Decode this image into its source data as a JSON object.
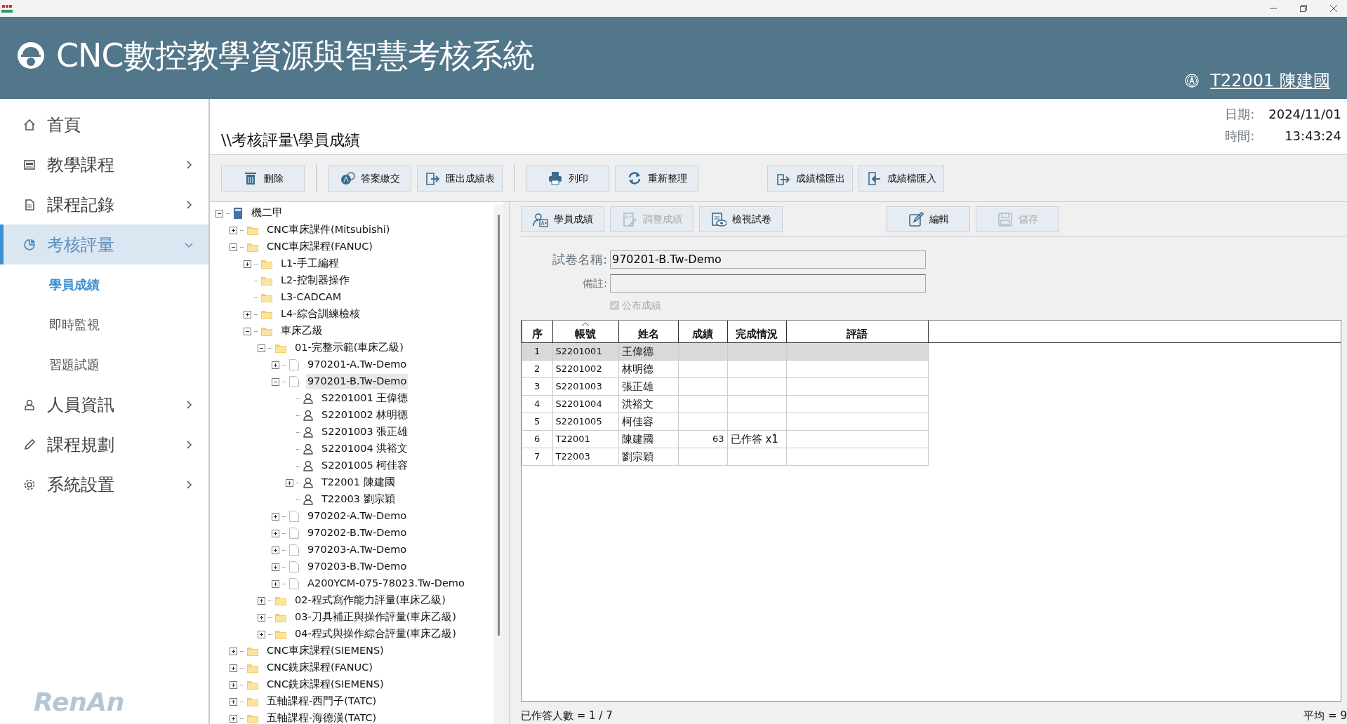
{
  "app": {
    "title": "CNC數控教學資源與智慧考核系統",
    "user": "T22001 陳建國"
  },
  "sidebar": {
    "items": [
      {
        "label": "首頁",
        "selected": false
      },
      {
        "label": "教學課程",
        "selected": false,
        "expanded": false
      },
      {
        "label": "課程記錄",
        "selected": false,
        "expanded": false
      },
      {
        "label": "考核評量",
        "selected": true,
        "expanded": true,
        "children": [
          {
            "label": "學員成績",
            "selected": true
          },
          {
            "label": "即時監視",
            "selected": false
          },
          {
            "label": "習題試題",
            "selected": false
          }
        ]
      },
      {
        "label": "人員資訊",
        "selected": false,
        "expanded": false
      },
      {
        "label": "課程規劃",
        "selected": false,
        "expanded": false
      },
      {
        "label": "系統設置",
        "selected": false,
        "expanded": false
      }
    ],
    "brand": "RenAn"
  },
  "breadcrumb": "\\\\考核評量\\學員成績",
  "date": {
    "label": "日期:",
    "value": "2024/11/01"
  },
  "time": {
    "label": "時間:",
    "value": "13:43:24"
  },
  "toolbar": [
    {
      "label": "刪除",
      "disabled": false,
      "separator_after": true
    },
    {
      "label": "答案繳交",
      "disabled": false,
      "separator_after": false
    },
    {
      "label": "匯出成績表",
      "disabled": false,
      "separator_after": true
    },
    {
      "label": "列印",
      "disabled": false,
      "separator_after": false
    },
    {
      "label": "重新整理",
      "disabled": false,
      "separator_after": false
    },
    {
      "label": "成績檔匯出",
      "disabled": false,
      "separator_after": false
    },
    {
      "label": "成績檔匯入",
      "disabled": false,
      "separator_after": false
    }
  ],
  "tree": [
    {
      "label": "機二甲",
      "kind": "group",
      "expanded": true,
      "selected": false,
      "children": [
        {
          "label": "CNC車床課件(Mitsubishi)",
          "kind": "folder",
          "expanded": false,
          "selected": false
        },
        {
          "label": "CNC車床課程(FANUC)",
          "kind": "folder",
          "expanded": true,
          "selected": false,
          "children": [
            {
              "label": "L1-手工編程",
              "kind": "folder",
              "expanded": false,
              "selected": false
            },
            {
              "label": "L2-控制器操作",
              "kind": "folder",
              "selected": false
            },
            {
              "label": "L3-CADCAM",
              "kind": "folder",
              "selected": false
            },
            {
              "label": "L4-綜合訓練檢核",
              "kind": "folder",
              "expanded": false,
              "selected": false
            },
            {
              "label": "車床乙級",
              "kind": "folder",
              "expanded": true,
              "selected": false,
              "children": [
                {
                  "label": "01-完整示範(車床乙級)",
                  "kind": "folder",
                  "expanded": true,
                  "selected": false,
                  "children": [
                    {
                      "label": "970201-A.Tw-Demo",
                      "kind": "paper",
                      "expanded": false,
                      "selected": false
                    },
                    {
                      "label": "970201-B.Tw-Demo",
                      "kind": "paper",
                      "expanded": true,
                      "selected": true,
                      "children": [
                        {
                          "label": "S2201001 王偉德",
                          "kind": "person",
                          "selected": false
                        },
                        {
                          "label": "S2201002 林明德",
                          "kind": "person",
                          "selected": false
                        },
                        {
                          "label": "S2201003 張正雄",
                          "kind": "person",
                          "selected": false
                        },
                        {
                          "label": "S2201004 洪裕文",
                          "kind": "person",
                          "selected": false
                        },
                        {
                          "label": "S2201005 柯佳容",
                          "kind": "person",
                          "selected": false
                        },
                        {
                          "label": "T22001 陳建國",
                          "kind": "person",
                          "expanded": false,
                          "selected": false
                        },
                        {
                          "label": "T22003 劉宗穎",
                          "kind": "person",
                          "selected": false
                        }
                      ]
                    },
                    {
                      "label": "970202-A.Tw-Demo",
                      "kind": "paper",
                      "expanded": false,
                      "selected": false
                    },
                    {
                      "label": "970202-B.Tw-Demo",
                      "kind": "paper",
                      "expanded": false,
                      "selected": false
                    },
                    {
                      "label": "970203-A.Tw-Demo",
                      "kind": "paper",
                      "expanded": false,
                      "selected": false
                    },
                    {
                      "label": "970203-B.Tw-Demo",
                      "kind": "paper",
                      "expanded": false,
                      "selected": false
                    },
                    {
                      "label": "A200YCM-075-78023.Tw-Demo",
                      "kind": "paper",
                      "expanded": false,
                      "selected": false
                    }
                  ]
                },
                {
                  "label": "02-程式寫作能力評量(車床乙級)",
                  "kind": "folder",
                  "expanded": false,
                  "selected": false
                },
                {
                  "label": "03-刀具補正與操作評量(車床乙級)",
                  "kind": "folder",
                  "expanded": false,
                  "selected": false
                },
                {
                  "label": "04-程式與操作綜合評量(車床乙級)",
                  "kind": "folder",
                  "expanded": false,
                  "selected": false
                }
              ]
            }
          ]
        },
        {
          "label": "CNC車床課程(SIEMENS)",
          "kind": "folder",
          "expanded": false,
          "selected": false
        },
        {
          "label": "CNC銑床課程(FANUC)",
          "kind": "folder",
          "expanded": false,
          "selected": false
        },
        {
          "label": "CNC銑床課程(SIEMENS)",
          "kind": "folder",
          "expanded": false,
          "selected": false
        },
        {
          "label": "五軸課程-西門子(TATC)",
          "kind": "folder",
          "expanded": false,
          "selected": false
        },
        {
          "label": "五軸課程-海德漢(TATC)",
          "kind": "folder",
          "expanded": false,
          "selected": false
        }
      ]
    }
  ],
  "tabs": [
    {
      "label": "學員成績",
      "disabled": false
    },
    {
      "label": "調整成績",
      "disabled": true
    },
    {
      "label": "檢視試卷",
      "disabled": false
    },
    {
      "label": "編輯",
      "disabled": false
    },
    {
      "label": "儲存",
      "disabled": true
    }
  ],
  "form": {
    "paper_name": {
      "label": "試卷名稱:",
      "value": "970201-B.Tw-Demo"
    },
    "remark": {
      "label": "備註:"
    },
    "publish": {
      "label": "公布成績",
      "checked": true,
      "disabled": true
    }
  },
  "table": {
    "columns": [
      {
        "label": "序",
        "sorted": false
      },
      {
        "label": "帳號",
        "sorted": true
      },
      {
        "label": "姓名",
        "sorted": false
      },
      {
        "label": "成績",
        "sorted": false
      },
      {
        "label": "完成情況",
        "sorted": false
      },
      {
        "label": "評語",
        "sorted": false
      }
    ],
    "rows": [
      {
        "cells": [
          "1",
          "S2201001",
          "王偉德",
          "",
          "",
          ""
        ],
        "selected": true
      },
      {
        "cells": [
          "2",
          "S2201002",
          "林明德",
          "",
          "",
          ""
        ],
        "selected": false
      },
      {
        "cells": [
          "3",
          "S2201003",
          "張正雄",
          "",
          "",
          ""
        ],
        "selected": false
      },
      {
        "cells": [
          "4",
          "S2201004",
          "洪裕文",
          "",
          "",
          ""
        ],
        "selected": false
      },
      {
        "cells": [
          "5",
          "S2201005",
          "柯佳容",
          "",
          "",
          ""
        ],
        "selected": false
      },
      {
        "cells": [
          "6",
          "T22001",
          "陳建國",
          "63",
          "已作答 x1",
          ""
        ],
        "selected": false
      },
      {
        "cells": [
          "7",
          "T22003",
          "劉宗穎",
          "",
          "",
          ""
        ],
        "selected": false
      }
    ]
  },
  "status_bar": {
    "answered": "已作答人數 = 1 / 7",
    "average": "平均 = 9"
  }
}
